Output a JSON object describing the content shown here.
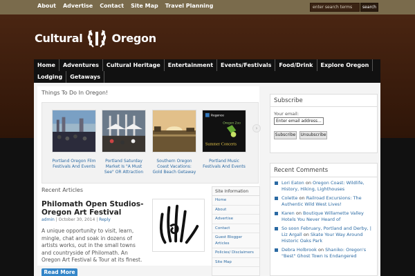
{
  "topnav": [
    "About",
    "Advertise",
    "Contact",
    "Site Map",
    "Travel Planning"
  ],
  "search": {
    "placeholder": "enter search terms",
    "button": "search"
  },
  "logo": {
    "left": "Cultural",
    "right": "Oregon"
  },
  "mainnav": [
    "Home",
    "Adventures",
    "Cultural Heritage",
    "Entertainment",
    "Events/Festivals",
    "Food/Drink",
    "Explore Oregon",
    "Lodging",
    "Getaways"
  ],
  "featured": {
    "title": "Things To Do In Oregon!",
    "slides": [
      {
        "caption": "Portland Oregon Film Festivals And Events"
      },
      {
        "caption": "Portland Saturday Market Is \"A Must See\" OR Attraction"
      },
      {
        "caption": "Southern Oregon Coast Vacations: Gold Beach Getaway"
      },
      {
        "caption": "Portland Music Festivals And Events"
      }
    ],
    "slide4_logo_text": "Regence",
    "slide4_sub_text": "Oregon Zoo",
    "slide4_title_text": "Summer Concerts"
  },
  "recent": {
    "heading": "Recent Articles",
    "article_title": "Philomath Open Studios-Oregon Art Festival",
    "author": "admin",
    "date": "October 30, 2014",
    "reply": "Reply",
    "excerpt": "A unique opportunity to visit, learn, mingle, chat and soak in dozens of artists works, out in the small towns and countryside of Philomath. An Oregon Art Festival & Tour at its finest.",
    "read_more": "Read More"
  },
  "siteinfo": {
    "heading": "Site Information",
    "items": [
      "Home",
      "About",
      "Advertise",
      "Contact",
      "Guest Blogger Articles",
      "Policies/ Disclaimers",
      "Site Map"
    ]
  },
  "subscribe": {
    "heading": "Subscribe",
    "email_label": "Your email:",
    "email_value": "Enter email address...",
    "subscribe_btn": "Subscribe",
    "unsubscribe_btn": "Unsubscribe"
  },
  "comments": {
    "heading": "Recent Comments",
    "items": [
      {
        "author": "Lori Eaton",
        "on": "on",
        "post": "Oregon Coast: Wildlife, History, Hiking, Lighthouses"
      },
      {
        "author": "Colette",
        "on": "on",
        "post": "Railroad Excursions: The Authentic Wild West Lives!"
      },
      {
        "author": "Karen",
        "on": "on",
        "post": "Boutique Willamette Valley Hotels You Never Heard of"
      },
      {
        "author": "So soon February, Portland and Derby, | Liz Argall",
        "on": "on",
        "post": "Skate Your Way Around Historic Oaks Park"
      },
      {
        "author": "Debra Holbrook",
        "on": "on",
        "post": "Shaniko: Oregon's \"Best\" Ghost Town Is Endangered"
      }
    ]
  },
  "colors": {
    "accent": "#2b6aa3",
    "topbar": "#7a6b4c",
    "header": "#4d2713",
    "button": "#3385c8"
  }
}
